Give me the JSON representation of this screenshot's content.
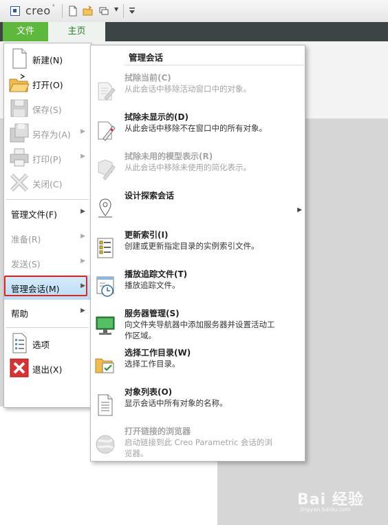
{
  "app": {
    "name": "creo",
    "tabs": [
      {
        "label": "文件"
      },
      {
        "label": "主页"
      }
    ]
  },
  "file_menu": {
    "items": [
      {
        "label": "新建(N)"
      },
      {
        "label": "打开(O)"
      },
      {
        "label": "保存(S)"
      },
      {
        "label": "另存为(A)"
      },
      {
        "label": "打印(P)"
      },
      {
        "label": "关闭(C)"
      },
      {
        "label": "管理文件(F)"
      },
      {
        "label": "准备(R)"
      },
      {
        "label": "发送(S)"
      },
      {
        "label": "管理会话(M)"
      },
      {
        "label": "帮助"
      },
      {
        "label": "选项"
      },
      {
        "label": "退出(X)"
      }
    ]
  },
  "submenu": {
    "title": "管理会话",
    "items": [
      {
        "title": "拭除当前(C)",
        "desc": "从此会话中移除活动窗口中的对象。"
      },
      {
        "title": "拭除未显示的(D)",
        "desc": "从此会话中移除不在窗口中的所有对象。"
      },
      {
        "title": "拭除未用的模型表示(R)",
        "desc": "从此会话中移除未使用的简化表示。"
      },
      {
        "title": "设计探索会话",
        "desc": ""
      },
      {
        "title": "更新索引(I)",
        "desc": "创建或更新指定目录的实例索引文件。"
      },
      {
        "title": "播放追踪文件(T)",
        "desc": "播放追踪文件。"
      },
      {
        "title": "服务器管理(S)",
        "desc": "向文件夹导航器中添加服务器并设置活动工作区域。"
      },
      {
        "title": "选择工作目录(W)",
        "desc": "选择工作目录。"
      },
      {
        "title": "对象列表(O)",
        "desc": "显示会话中所有对象的名称。"
      },
      {
        "title": "打开链接的浏览器",
        "desc": "启动链接到此 Creo Parametric 会话的浏览器。"
      }
    ]
  },
  "watermark": {
    "text": "Bai 经验",
    "sub": "jingyan.baidu.com"
  },
  "colors": {
    "file_tab": "#5db83c",
    "highlight": "#b9dcf6",
    "outline": "#e0241f"
  }
}
